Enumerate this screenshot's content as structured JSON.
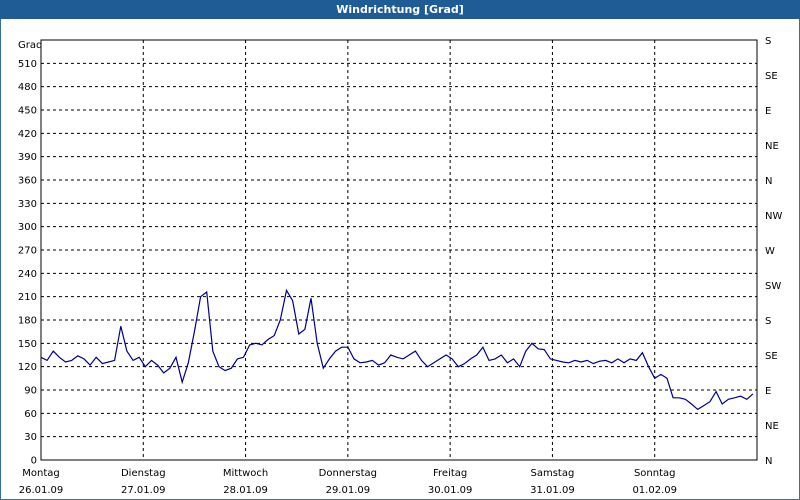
{
  "window": {
    "title": "Windrichtung [Grad]"
  },
  "chart_data": {
    "type": "line",
    "title": "Windrichtung [Grad]",
    "ylabel": "Grad",
    "ylim": [
      0,
      540
    ],
    "grid": true,
    "y_ticks": [
      0,
      30,
      60,
      90,
      120,
      150,
      180,
      210,
      240,
      270,
      300,
      330,
      360,
      390,
      420,
      450,
      480,
      510
    ],
    "right_axis_labels": [
      "N",
      "NE",
      "E",
      "SE",
      "S",
      "SW",
      "W",
      "NW",
      "N",
      "NE",
      "E",
      "SE",
      "S"
    ],
    "x_labels": [
      {
        "day": "Montag",
        "date": "26.01.09"
      },
      {
        "day": "Dienstag",
        "date": "27.01.09"
      },
      {
        "day": "Mittwoch",
        "date": "28.01.09"
      },
      {
        "day": "Donnerstag",
        "date": "29.01.09"
      },
      {
        "day": "Freitag",
        "date": "30.01.09"
      },
      {
        "day": "Samstag",
        "date": "31.01.09"
      },
      {
        "day": "Sonntag",
        "date": "01.02.09"
      }
    ],
    "xlim_days": [
      0,
      7.0
    ],
    "series": [
      {
        "color": "#00008b",
        "x": [
          0.0,
          0.06,
          0.12,
          0.18,
          0.24,
          0.3,
          0.36,
          0.42,
          0.48,
          0.54,
          0.6,
          0.66,
          0.72,
          0.78,
          0.84,
          0.9,
          0.96,
          1.02,
          1.08,
          1.14,
          1.2,
          1.26,
          1.32,
          1.38,
          1.44,
          1.5,
          1.56,
          1.62,
          1.68,
          1.74,
          1.8,
          1.86,
          1.92,
          1.98,
          2.04,
          2.1,
          2.16,
          2.22,
          2.28,
          2.34,
          2.4,
          2.46,
          2.52,
          2.58,
          2.64,
          2.7,
          2.76,
          2.82,
          2.88,
          2.94,
          3.0,
          3.06,
          3.12,
          3.18,
          3.24,
          3.3,
          3.36,
          3.42,
          3.48,
          3.54,
          3.6,
          3.66,
          3.72,
          3.78,
          3.84,
          3.9,
          3.96,
          4.02,
          4.08,
          4.14,
          4.2,
          4.26,
          4.32,
          4.38,
          4.44,
          4.5,
          4.56,
          4.62,
          4.68,
          4.74,
          4.8,
          4.86,
          4.92,
          4.98,
          5.04,
          5.1,
          5.16,
          5.22,
          5.28,
          5.34,
          5.4,
          5.46,
          5.52,
          5.58,
          5.64,
          5.7,
          5.76,
          5.82,
          5.88,
          5.94,
          6.0,
          6.06,
          6.12,
          6.18,
          6.24,
          6.3,
          6.36,
          6.42,
          6.48,
          6.54,
          6.6,
          6.66,
          6.72,
          6.78,
          6.84,
          6.9,
          6.96
        ],
        "y": [
          132,
          128,
          140,
          132,
          126,
          128,
          134,
          130,
          122,
          132,
          124,
          126,
          128,
          172,
          140,
          128,
          132,
          120,
          128,
          122,
          112,
          118,
          132,
          100,
          125,
          165,
          210,
          216,
          140,
          120,
          115,
          118,
          130,
          132,
          148,
          150,
          148,
          155,
          160,
          180,
          218,
          205,
          162,
          168,
          208,
          150,
          118,
          130,
          140,
          145,
          145,
          130,
          125,
          126,
          128,
          122,
          125,
          135,
          132,
          130,
          135,
          140,
          128,
          120,
          125,
          130,
          135,
          130,
          120,
          124,
          130,
          135,
          145,
          128,
          130,
          135,
          125,
          130,
          120,
          140,
          150,
          143,
          142,
          130,
          128,
          126,
          125,
          128,
          126,
          128,
          124,
          127,
          128,
          125,
          130,
          125,
          130,
          128,
          138,
          120,
          105,
          110,
          105,
          80,
          80,
          78,
          72,
          65,
          70,
          75,
          88,
          72,
          78,
          80,
          82,
          78,
          85
        ]
      }
    ]
  }
}
